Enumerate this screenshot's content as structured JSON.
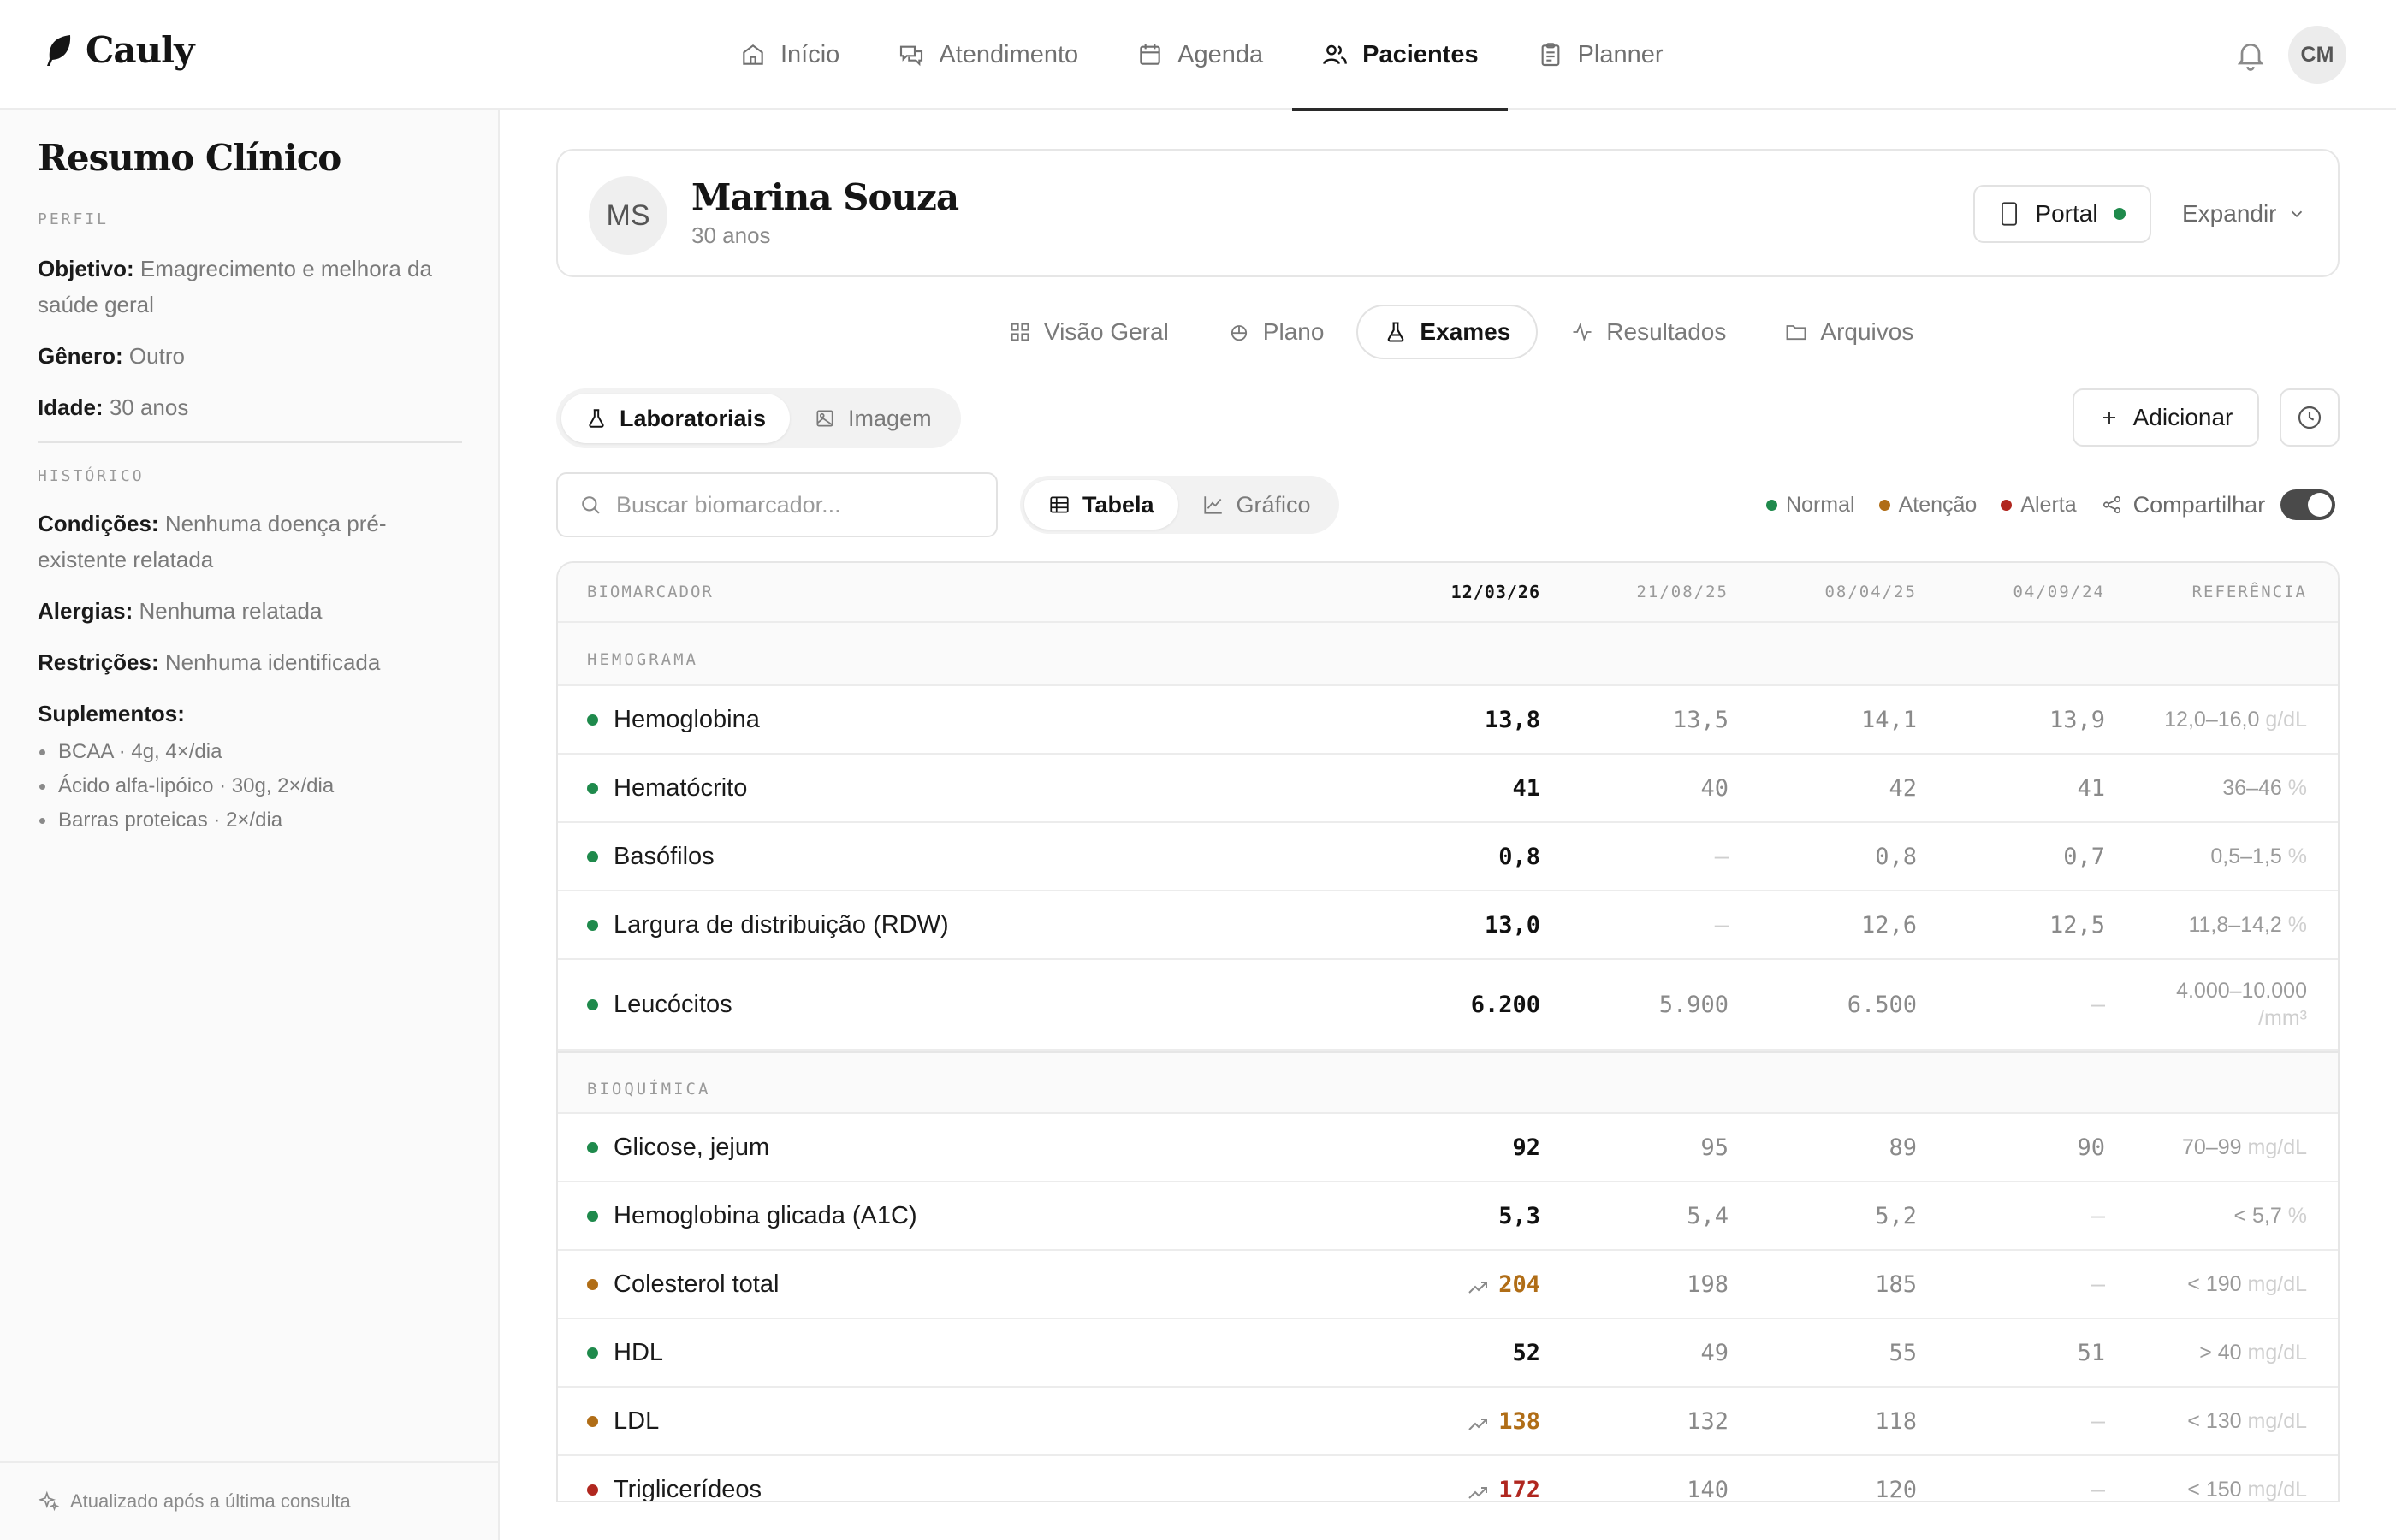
{
  "app": {
    "brand": "Cauly",
    "nav": [
      {
        "label": "Início",
        "icon": "home-icon"
      },
      {
        "label": "Atendimento",
        "icon": "chat-icon"
      },
      {
        "label": "Agenda",
        "icon": "calendar-icon"
      },
      {
        "label": "Pacientes",
        "icon": "users-icon",
        "active": true
      },
      {
        "label": "Planner",
        "icon": "clipboard-icon"
      }
    ],
    "user_initials": "CM"
  },
  "sidebar": {
    "title": "Resumo Clínico",
    "profile_label": "PERFIL",
    "objective_key": "Objetivo:",
    "objective_val": "Emagrecimento e melhora da saúde geral",
    "gender_key": "Gênero:",
    "gender_val": "Outro",
    "age_key": "Idade:",
    "age_val": "30 anos",
    "history_label": "HISTÓRICO",
    "conditions_key": "Condições:",
    "conditions_val": "Nenhuma doença pré-existente relatada",
    "allergies_key": "Alergias:",
    "allergies_val": "Nenhuma relatada",
    "restrictions_key": "Restrições:",
    "restrictions_val": "Nenhuma identificada",
    "supplements_key": "Suplementos:",
    "supplements": [
      "BCAA · 4g, 4×/dia",
      "Ácido alfa-lipóico · 30g, 2×/dia",
      "Barras proteicas · 2×/dia"
    ],
    "footer": "Atualizado após a última consulta"
  },
  "patient": {
    "initials": "MS",
    "name": "Marina Souza",
    "age": "30 anos",
    "portal_label": "Portal",
    "expand_label": "Expandir"
  },
  "subtabs": [
    {
      "label": "Visão Geral",
      "icon": "grid-icon"
    },
    {
      "label": "Plano",
      "icon": "plate-icon"
    },
    {
      "label": "Exames",
      "icon": "flask-icon",
      "active": true
    },
    {
      "label": "Resultados",
      "icon": "activity-icon"
    },
    {
      "label": "Arquivos",
      "icon": "folder-icon"
    }
  ],
  "exam_types": {
    "lab": "Laboratoriais",
    "image": "Imagem"
  },
  "actions": {
    "add": "Adicionar"
  },
  "search": {
    "placeholder": "Buscar biomarcador..."
  },
  "views": {
    "table": "Tabela",
    "chart": "Gráfico"
  },
  "legend": {
    "normal": "Normal",
    "attention": "Atenção",
    "alert": "Alerta",
    "share": "Compartilhar",
    "colors": {
      "normal": "#1f8a4c",
      "attention": "#b06d16",
      "alert": "#b0271f"
    }
  },
  "table": {
    "header": {
      "name": "BIOMARCADOR",
      "d1": "12/03/26",
      "d2": "21/08/25",
      "d3": "08/04/25",
      "d4": "04/09/24",
      "ref": "REFERÊNCIA"
    },
    "groups": [
      {
        "name": "HEMOGRAMA",
        "rows": [
          {
            "name": "Hemoglobina",
            "status": "normal",
            "v": [
              "13,8",
              "13,5",
              "14,1",
              "13,9"
            ],
            "ref": "12,0–16,0",
            "unit": "g/dL"
          },
          {
            "name": "Hematócrito",
            "status": "normal",
            "v": [
              "41",
              "40",
              "42",
              "41"
            ],
            "ref": "36–46",
            "unit": "%"
          },
          {
            "name": "Basófilos",
            "status": "normal",
            "v": [
              "0,8",
              "—",
              "0,8",
              "0,7"
            ],
            "ref": "0,5–1,5",
            "unit": "%"
          },
          {
            "name": "Largura de distribuição (RDW)",
            "status": "normal",
            "v": [
              "13,0",
              "—",
              "12,6",
              "12,5"
            ],
            "ref": "11,8–14,2",
            "unit": "%"
          },
          {
            "name": "Leucócitos",
            "status": "normal",
            "v": [
              "6.200",
              "5.900",
              "6.500",
              "—"
            ],
            "ref": "4.000–10.000",
            "unit": "/mm³"
          }
        ]
      },
      {
        "name": "BIOQUÍMICA",
        "rows": [
          {
            "name": "Glicose, jejum",
            "status": "normal",
            "v": [
              "92",
              "95",
              "89",
              "90"
            ],
            "ref": "70–99",
            "unit": "mg/dL"
          },
          {
            "name": "Hemoglobina glicada (A1C)",
            "status": "normal",
            "v": [
              "5,3",
              "5,4",
              "5,2",
              "—"
            ],
            "ref": "< 5,7",
            "unit": "%"
          },
          {
            "name": "Colesterol total",
            "status": "attention",
            "v": [
              "204",
              "198",
              "185",
              "—"
            ],
            "ref": "< 190",
            "unit": "mg/dL"
          },
          {
            "name": "HDL",
            "status": "normal",
            "v": [
              "52",
              "49",
              "55",
              "51"
            ],
            "ref": "> 40",
            "unit": "mg/dL"
          },
          {
            "name": "LDL",
            "status": "attention",
            "v": [
              "138",
              "132",
              "118",
              "—"
            ],
            "ref": "< 130",
            "unit": "mg/dL"
          },
          {
            "name": "Triglicerídeos",
            "status": "alert",
            "v": [
              "172",
              "140",
              "120",
              "—"
            ],
            "ref": "< 150",
            "unit": "mg/dL"
          }
        ]
      }
    ]
  }
}
